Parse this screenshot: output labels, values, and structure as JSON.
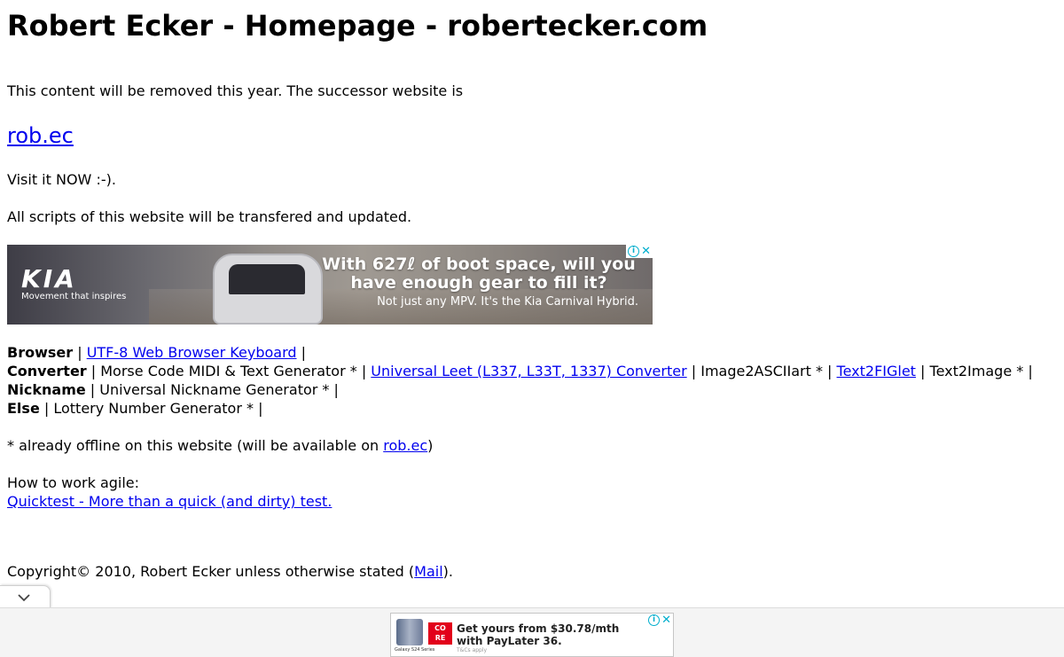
{
  "page": {
    "title": "Robert Ecker - Homepage - robertecker.com",
    "intro": "This content will be removed this year. The successor website is",
    "successor_link": "rob.ec",
    "visit": "Visit it NOW :-).",
    "transfer": "All scripts of this website will be transfered and updated."
  },
  "ad_banner": {
    "brand": "KIA",
    "tagline": "Movement that inspires",
    "headline": "With 627ℓ of boot space, will you have enough gear to fill it?",
    "subline": "Not just any MPV. It's the Kia Carnival Hybrid.",
    "adchoices_icon": "info-icon",
    "close_icon": "close-icon"
  },
  "categories": [
    {
      "name": "Browser",
      "items": [
        {
          "label": "UTF-8 Web Browser Keyboard",
          "link": true
        }
      ]
    },
    {
      "name": "Converter",
      "items": [
        {
          "label": "Morse Code MIDI & Text Generator *",
          "link": false
        },
        {
          "label": "Universal Leet (L337, L33T, 1337) Converter",
          "link": true
        },
        {
          "label": "Image2ASCIIart *",
          "link": false
        },
        {
          "label": "Text2FIGlet",
          "link": true
        },
        {
          "label": "Text2Image *",
          "link": false
        }
      ]
    },
    {
      "name": "Nickname",
      "items": [
        {
          "label": "Universal Nickname Generator *",
          "link": false
        }
      ]
    },
    {
      "name": "Else",
      "items": [
        {
          "label": "Lottery Number Generator *",
          "link": false
        }
      ]
    }
  ],
  "separator": "|",
  "note": {
    "prefix": "* already offline on this website (will be available on ",
    "link": "rob.ec",
    "suffix": ")"
  },
  "agile": {
    "heading": "How to work agile:",
    "link": "Quicktest - More than a quick (and dirty) test."
  },
  "footer": {
    "prefix": "Copyright© 2010, Robert Ecker unless otherwise stated (",
    "link": "Mail",
    "suffix": ")."
  },
  "bottom_ad": {
    "brand": "CORE",
    "message_line1": "Get yours from $30.78/mth",
    "message_line2": "with PayLater 36.",
    "fine_print": "T&Cs apply",
    "phone_caption": "Galaxy S24 Series"
  },
  "colors": {
    "link": "#0000ee",
    "adchoices": "#00aecd",
    "core_red": "#e2001a"
  }
}
